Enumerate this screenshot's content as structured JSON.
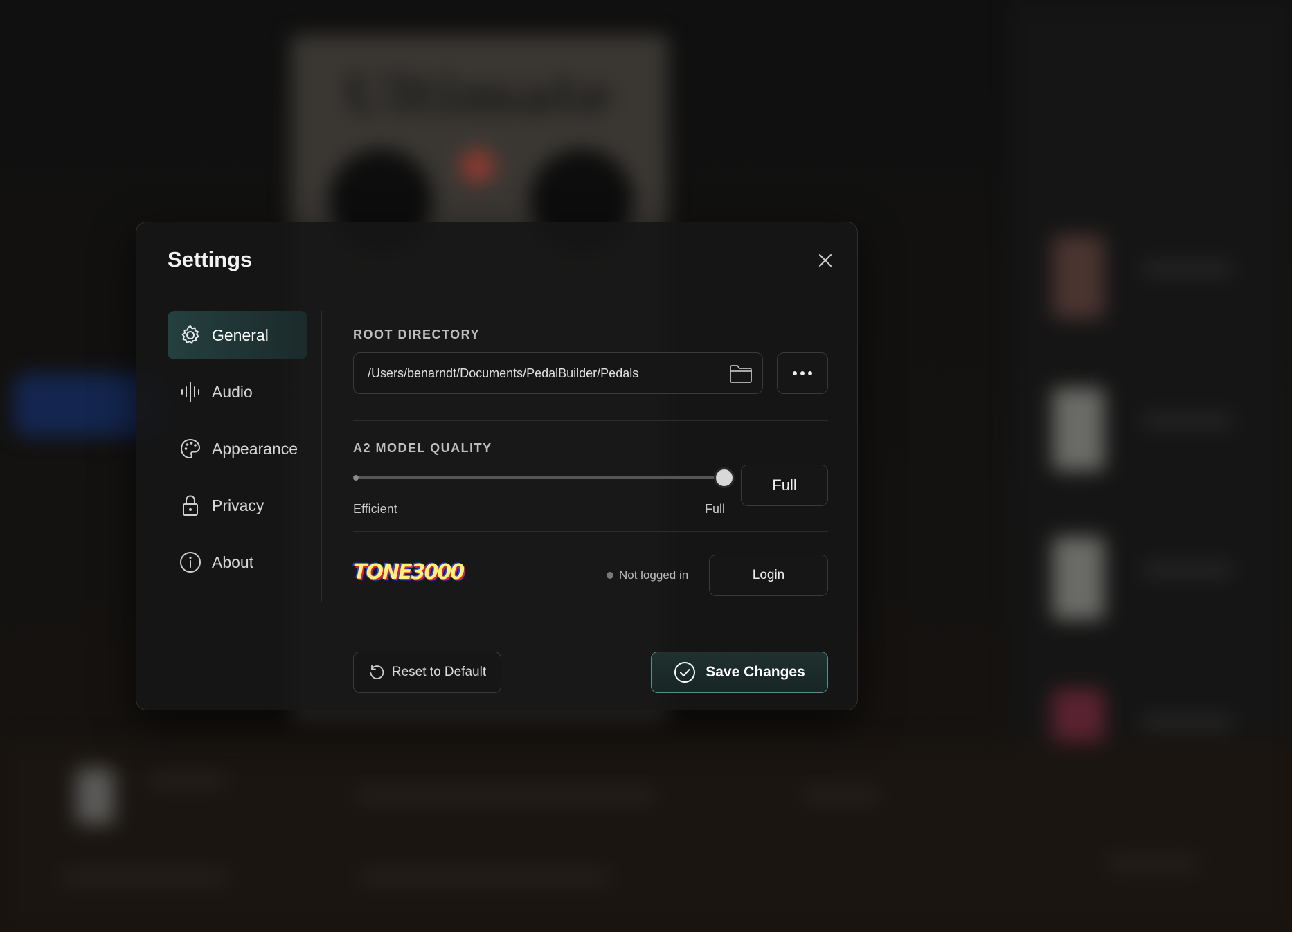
{
  "settings": {
    "title": "Settings",
    "nav": [
      {
        "label": "General",
        "icon": "gear-icon",
        "active": true
      },
      {
        "label": "Audio",
        "icon": "waveform-icon",
        "active": false
      },
      {
        "label": "Appearance",
        "icon": "palette-icon",
        "active": false
      },
      {
        "label": "Privacy",
        "icon": "lock-icon",
        "active": false
      },
      {
        "label": "About",
        "icon": "info-icon",
        "active": false
      }
    ],
    "root_directory": {
      "label": "ROOT DIRECTORY",
      "path": "/Users/benarndt/Documents/PedalBuilder/Pedals"
    },
    "model_quality": {
      "label": "A2 MODEL QUALITY",
      "min_label": "Efficient",
      "max_label": "Full",
      "value": 1.0,
      "selected": "Full"
    },
    "tone3000": {
      "logo_text": "TONE3000",
      "status": "Not logged in",
      "login_label": "Login"
    },
    "footer": {
      "reset_label": "Reset to Default",
      "save_label": "Save Changes"
    },
    "colors": {
      "accent": "#5a8e8a",
      "active_nav": "#24403f"
    }
  }
}
